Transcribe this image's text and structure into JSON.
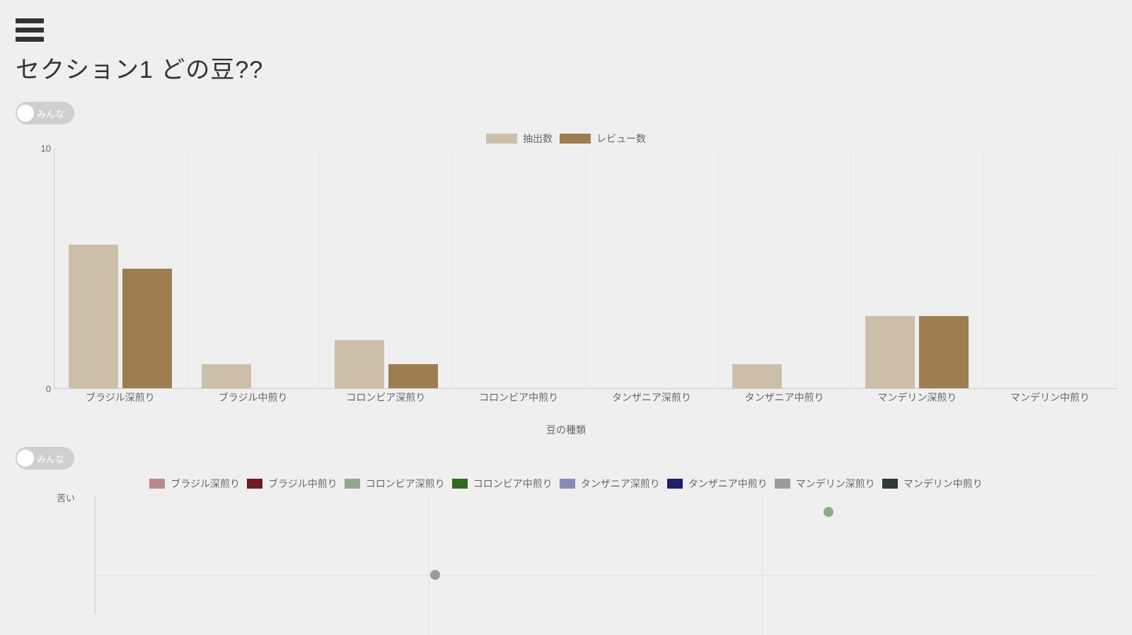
{
  "header": {
    "title": "セクション1 どの豆??"
  },
  "toggle": {
    "label": "みんな"
  },
  "chart_data": [
    {
      "type": "bar",
      "title": "",
      "xlabel": "豆の種類",
      "ylabel": "",
      "ylim": [
        0,
        10
      ],
      "categories": [
        "ブラジル深煎り",
        "ブラジル中煎り",
        "コロンビア深煎り",
        "コロンビア中煎り",
        "タンザニア深煎り",
        "タンザニア中煎り",
        "マンデリン深煎り",
        "マンデリン中煎り"
      ],
      "series": [
        {
          "name": "抽出数",
          "color": "#cbbfa9",
          "values": [
            6,
            1,
            2,
            0,
            0,
            1,
            3,
            0
          ]
        },
        {
          "name": "レビュー数",
          "color": "#9d7d51",
          "values": [
            5,
            0,
            1,
            0,
            0,
            0,
            3,
            0
          ]
        }
      ]
    },
    {
      "type": "scatter",
      "title": "",
      "xlabel": "",
      "ylabel_top": "苦い",
      "x_gridlines": [
        1,
        2
      ],
      "xlim": [
        0,
        3
      ],
      "ylim": [
        0,
        3
      ],
      "series": [
        {
          "name": "ブラジル深煎り",
          "color": "#b98a8a",
          "points": []
        },
        {
          "name": "ブラジル中煎り",
          "color": "#6b1f1f",
          "points": []
        },
        {
          "name": "コロンビア深煎り",
          "color": "#8fa98a",
          "points": [
            [
              2.2,
              2.6
            ]
          ]
        },
        {
          "name": "コロンビア中煎り",
          "color": "#2f6b1f",
          "points": []
        },
        {
          "name": "タンザニア深煎り",
          "color": "#8a8ab9",
          "points": []
        },
        {
          "name": "タンザニア中煎り",
          "color": "#1f1f6b",
          "points": []
        },
        {
          "name": "マンデリン深煎り",
          "color": "#9a9a9a",
          "points": [
            [
              1.02,
              1.0
            ]
          ]
        },
        {
          "name": "マンデリン中煎り",
          "color": "#2f3a3a",
          "points": []
        }
      ]
    }
  ]
}
